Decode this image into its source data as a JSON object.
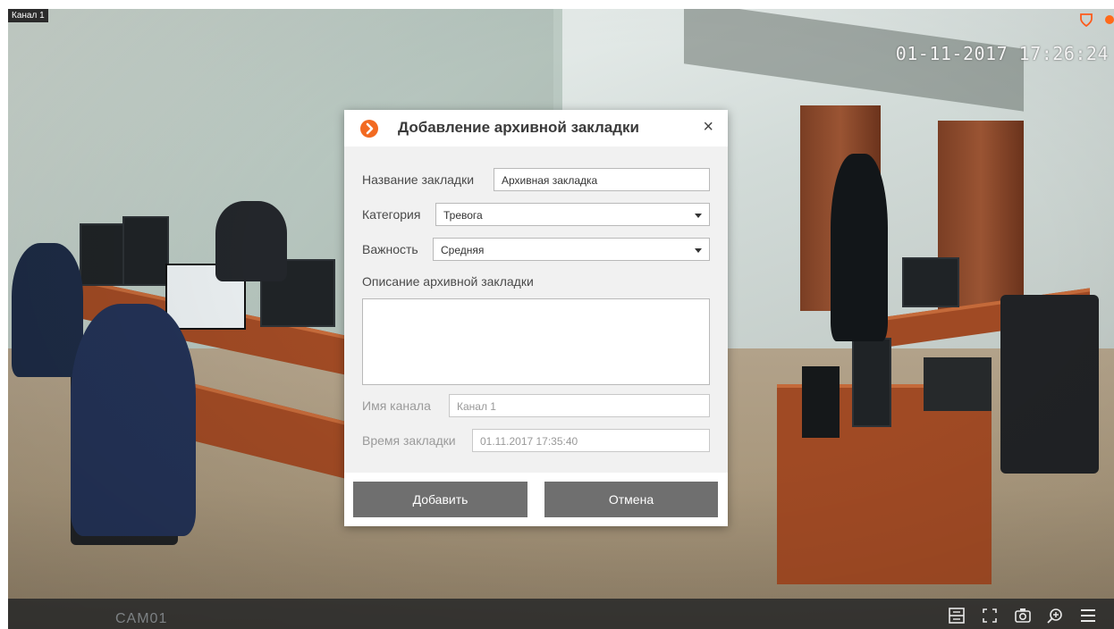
{
  "viewer": {
    "channel_label": "Канал 1",
    "timestamp": "01-11-2017 17:26:24",
    "camera_name": "CAM01",
    "recording_color": "#ff6a1a"
  },
  "toolbar": {
    "icons": [
      "timeline-icon",
      "fullscreen-icon",
      "snapshot-icon",
      "zoom-icon",
      "menu-icon"
    ]
  },
  "dialog": {
    "title": "Добавление архивной закладки",
    "close_label": "×",
    "accent_color": "#f26a21",
    "fields": {
      "name": {
        "label": "Название закладки",
        "value": "Архивная закладка"
      },
      "category": {
        "label": "Категория",
        "value": "Тревога"
      },
      "importance": {
        "label": "Важность",
        "value": "Средняя"
      },
      "description": {
        "label": "Описание архивной закладки",
        "value": ""
      },
      "channel": {
        "label": "Имя канала",
        "value": "Канал 1"
      },
      "time": {
        "label": "Время закладки",
        "value": "01.11.2017 17:35:40"
      }
    },
    "buttons": {
      "add": "Добавить",
      "cancel": "Отмена"
    }
  }
}
